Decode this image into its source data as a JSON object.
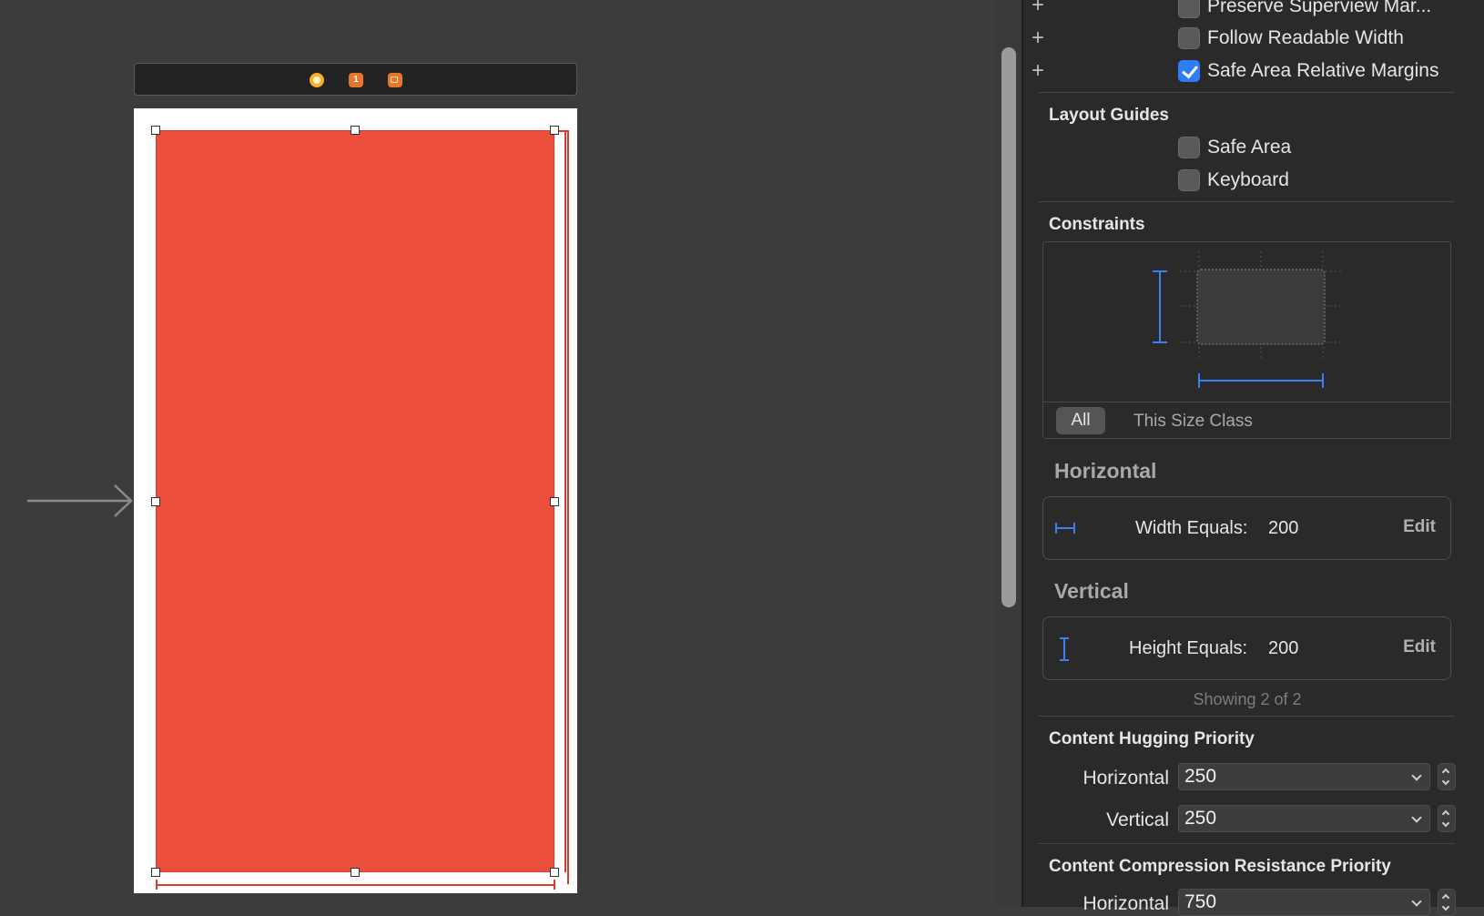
{
  "scene_bar": {
    "icons": [
      "view-controller-icon",
      "first-responder-icon",
      "exit-icon"
    ],
    "first_responder_glyph": "1"
  },
  "inspector": {
    "view_options": [
      {
        "label": "Preserve Superview Mar...",
        "checked": false
      },
      {
        "label": "Follow Readable Width",
        "checked": false
      },
      {
        "label": "Safe Area Relative Margins",
        "checked": true
      }
    ],
    "layout_guides": {
      "title": "Layout Guides",
      "items": [
        {
          "label": "Safe Area",
          "checked": false
        },
        {
          "label": "Keyboard",
          "checked": false
        }
      ]
    },
    "constraints": {
      "title": "Constraints",
      "scope_all": "All",
      "scope_size_class": "This Size Class",
      "horizontal_title": "Horizontal",
      "vertical_title": "Vertical",
      "width": {
        "label": "Width Equals:",
        "value": "200",
        "edit": "Edit"
      },
      "height": {
        "label": "Height Equals:",
        "value": "200",
        "edit": "Edit"
      },
      "showing": "Showing 2 of 2"
    },
    "hugging": {
      "title": "Content Hugging Priority",
      "horizontal_label": "Horizontal",
      "horizontal_value": "250",
      "vertical_label": "Vertical",
      "vertical_value": "250"
    },
    "compression": {
      "title": "Content Compression Resistance Priority",
      "horizontal_label": "Horizontal",
      "horizontal_value": "750"
    }
  },
  "colors": {
    "view_background": "#eb4e3d",
    "accent": "#2f7cf6",
    "canvas": "#3c3c3c",
    "inspector": "#2a2a2a"
  }
}
